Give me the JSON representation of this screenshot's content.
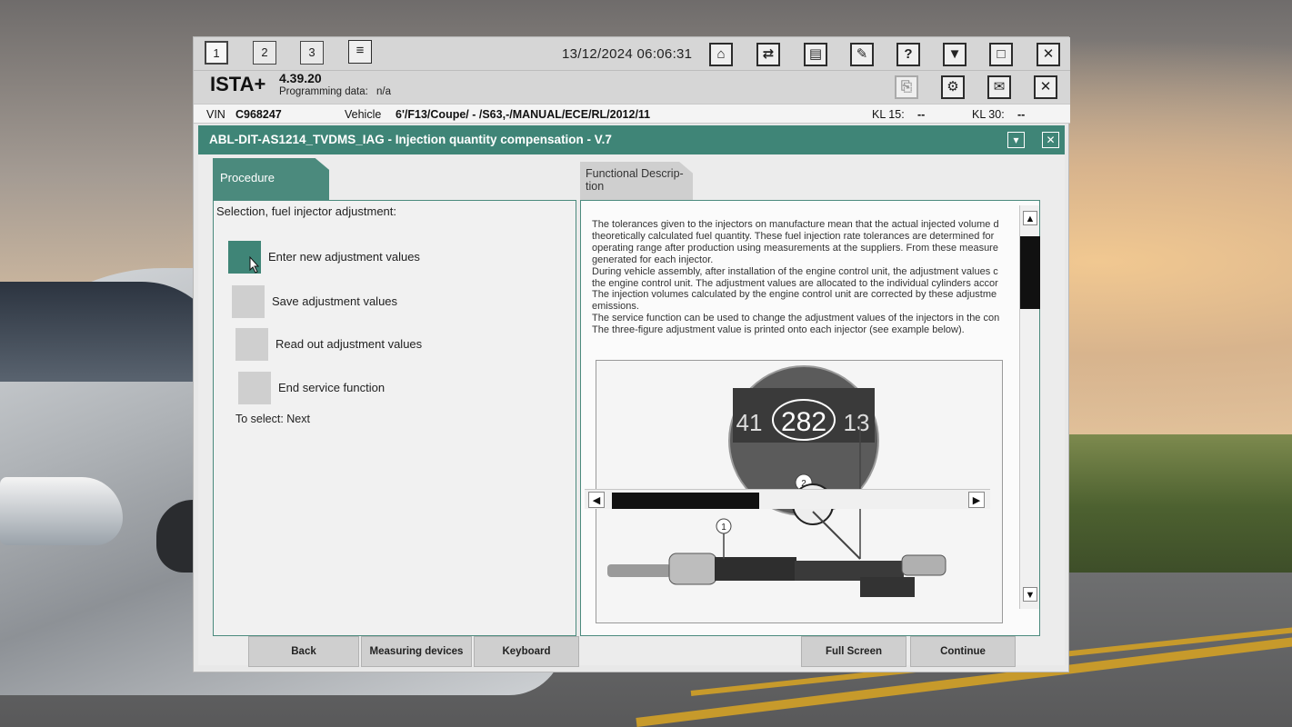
{
  "toolbar": {
    "tabs": [
      "1",
      "2",
      "3"
    ],
    "datetime": "13/12/2024 06:06:31",
    "icons": [
      "list-icon",
      "home-icon",
      "vehicle-data-icon",
      "print-icon",
      "wrench-icon",
      "help-icon",
      "download-icon",
      "maximize-icon",
      "close-icon"
    ],
    "help_glyph": "?"
  },
  "brand": {
    "name": "ISTA+",
    "version": "4.39.20",
    "programming_label": "Programming data:",
    "programming_value": "n/a"
  },
  "vehicle_bar": {
    "vin_label": "VIN",
    "vin_value": "C968247",
    "vehicle_label": "Vehicle",
    "vehicle_value": "6'/F13/Coupe/ - /S63,-/MANUAL/ECE/RL/2012/11",
    "kl15_label": "KL 15:",
    "kl15_value": "--",
    "kl30_label": "KL 30:",
    "kl30_value": "--"
  },
  "title": "ABL-DIT-AS1214_TVDMS_IAG - Injection quantity compensation - V.7",
  "tabs": {
    "procedure": "Procedure",
    "functional": "Functional Descrip-tion"
  },
  "procedure": {
    "selection_label": "Selection, fuel injector adjustment:",
    "options": [
      "Enter new adjustment values",
      "Save adjustment values",
      "Read out adjustment values",
      "End service function"
    ],
    "to_select": "To select: Next"
  },
  "description": [
    "The tolerances given to the injectors on manufacture mean that the actual injected volume d",
    "theoretically calculated fuel quantity. These fuel injection rate tolerances are determined for",
    "operating range after production using measurements at the suppliers. From these measure",
    "generated for each injector.",
    "During vehicle assembly, after installation of the engine control unit, the adjustment values c",
    "the engine control unit. The adjustment values are allocated to the individual cylinders accor",
    "The injection volumes calculated by the engine control unit are corrected by these adjustme",
    "emissions.",
    "The service function can be used to change the adjustment values of the injectors in the con",
    "The three-figure adjustment value is printed onto each injector (see example below)."
  ],
  "illustration": {
    "value_main": "282",
    "value_left": "41",
    "value_right": "13",
    "callout_1": "1",
    "callout_2": "2"
  },
  "buttons": {
    "back": "Back",
    "measuring": "Measuring devices",
    "keyboard": "Keyboard",
    "fullscreen": "Full Screen",
    "continue": "Continue"
  },
  "colors": {
    "accent": "#3f8577",
    "tab": "#4b8a7d"
  }
}
